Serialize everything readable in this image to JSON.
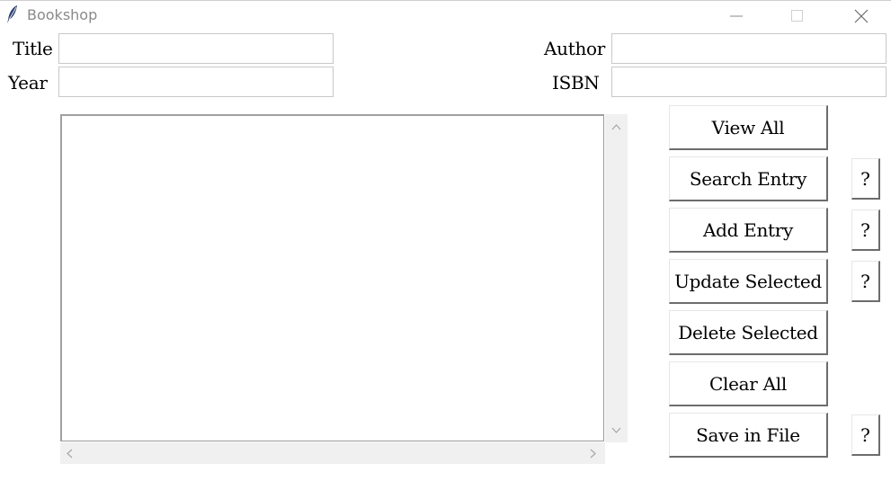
{
  "window": {
    "title": "Bookshop",
    "controls": {
      "minimize": "minimize",
      "maximize": "maximize",
      "close": "close"
    }
  },
  "form": {
    "title_label": "Title",
    "author_label": "Author",
    "year_label": "Year",
    "isbn_label": "ISBN",
    "title_value": "",
    "author_value": "",
    "year_value": "",
    "isbn_value": ""
  },
  "listbox": {
    "items": []
  },
  "buttons": {
    "view_all": "View All",
    "search_entry": "Search Entry",
    "add_entry": "Add Entry",
    "update_selected": "Update Selected",
    "delete_selected": "Delete Selected",
    "clear_all": "Clear All",
    "save_in_file": "Save in File",
    "help": "?"
  },
  "icons": {
    "app": "feather-icon",
    "scroll_up": "chevron-up-icon",
    "scroll_down": "chevron-down-icon",
    "scroll_left": "chevron-left-icon",
    "scroll_right": "chevron-right-icon"
  }
}
